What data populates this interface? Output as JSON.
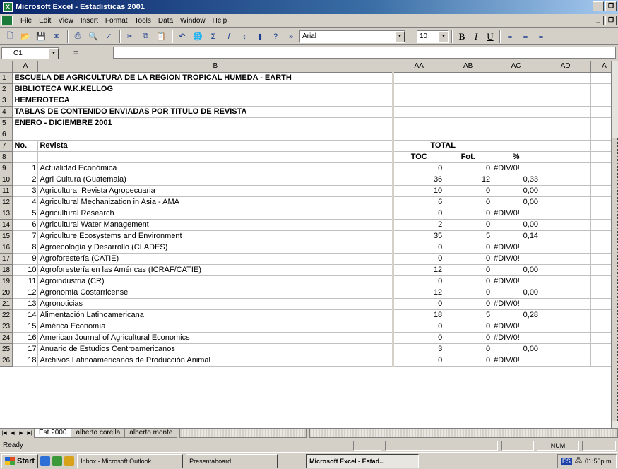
{
  "window": {
    "title": "Microsoft Excel - Estadísticas 2001"
  },
  "menu": [
    "File",
    "Edit",
    "View",
    "Insert",
    "Format",
    "Tools",
    "Data",
    "Window",
    "Help"
  ],
  "toolbar": {
    "font": "Arial",
    "size": "10",
    "bold": "B",
    "italic": "I",
    "underline": "U"
  },
  "formula": {
    "cell": "C1",
    "eq": "="
  },
  "columns": [
    "A",
    "B",
    "AA",
    "AB",
    "AC",
    "AD",
    "A"
  ],
  "header_rows": [
    {
      "n": "1",
      "text": "ESCUELA DE AGRICULTURA DE LA REGION TROPICAL HUMEDA - EARTH"
    },
    {
      "n": "2",
      "text": "BIBLIOTECA W.K.KELLOG"
    },
    {
      "n": "3",
      "text": "HEMEROTECA"
    },
    {
      "n": "4",
      "text": "TABLAS DE CONTENIDO ENVIADAS POR TITULO DE REVISTA"
    },
    {
      "n": "5",
      "text": "ENERO - DICIEMBRE 2001"
    },
    {
      "n": "6",
      "text": ""
    }
  ],
  "labels": {
    "row7_num": "7",
    "no": "No.",
    "revista": "Revista",
    "total": "TOTAL",
    "row8_num": "8",
    "toc": "TOC",
    "fot": "Fot.",
    "pct": "%"
  },
  "rows": [
    {
      "n": "9",
      "no": "1",
      "revista": "Actualidad Económica",
      "toc": "0",
      "fot": "0",
      "pct": "#DIV/0!"
    },
    {
      "n": "10",
      "no": "2",
      "revista": "Agri Cultura (Guatemala)",
      "toc": "36",
      "fot": "12",
      "pct": "0,33"
    },
    {
      "n": "11",
      "no": "3",
      "revista": "Agricultura: Revista Agropecuaria",
      "toc": "10",
      "fot": "0",
      "pct": "0,00"
    },
    {
      "n": "12",
      "no": "4",
      "revista": "Agricultural Mechanization in Asia - AMA",
      "toc": "6",
      "fot": "0",
      "pct": "0,00"
    },
    {
      "n": "13",
      "no": "5",
      "revista": "Agricultural Research",
      "toc": "0",
      "fot": "0",
      "pct": "#DIV/0!"
    },
    {
      "n": "14",
      "no": "6",
      "revista": "Agricultural Water Management",
      "toc": "2",
      "fot": "0",
      "pct": "0,00"
    },
    {
      "n": "15",
      "no": "7",
      "revista": "Agriculture Ecosystems and Environment",
      "toc": "35",
      "fot": "5",
      "pct": "0,14"
    },
    {
      "n": "16",
      "no": "8",
      "revista": "Agroecología y Desarrollo (CLADES)",
      "toc": "0",
      "fot": "0",
      "pct": "#DIV/0!"
    },
    {
      "n": "17",
      "no": "9",
      "revista": "Agroforestería (CATIE)",
      "toc": "0",
      "fot": "0",
      "pct": "#DIV/0!"
    },
    {
      "n": "18",
      "no": "10",
      "revista": "Agroforestería en las Américas (ICRAF/CATIE)",
      "toc": "12",
      "fot": "0",
      "pct": "0,00"
    },
    {
      "n": "19",
      "no": "11",
      "revista": "Agroindustria (CR)",
      "toc": "0",
      "fot": "0",
      "pct": "#DIV/0!"
    },
    {
      "n": "20",
      "no": "12",
      "revista": "Agronomía Costarricense",
      "toc": "12",
      "fot": "0",
      "pct": "0,00"
    },
    {
      "n": "21",
      "no": "13",
      "revista": "Agronoticias",
      "toc": "0",
      "fot": "0",
      "pct": "#DIV/0!"
    },
    {
      "n": "22",
      "no": "14",
      "revista": "Alimentación Latinoamericana",
      "toc": "18",
      "fot": "5",
      "pct": "0,28"
    },
    {
      "n": "23",
      "no": "15",
      "revista": "América Economía",
      "toc": "0",
      "fot": "0",
      "pct": "#DIV/0!"
    },
    {
      "n": "24",
      "no": "16",
      "revista": "American Journal of Agricultural Economics",
      "toc": "0",
      "fot": "0",
      "pct": "#DIV/0!"
    },
    {
      "n": "25",
      "no": "17",
      "revista": "Anuario de Estudios Centroamericanos",
      "toc": "3",
      "fot": "0",
      "pct": "0,00"
    },
    {
      "n": "26",
      "no": "18",
      "revista": "Archivos Latinoamericanos de Producción Animal",
      "toc": "0",
      "fot": "0",
      "pct": "#DIV/0!"
    }
  ],
  "sheet_tabs": [
    "Est.2000",
    "alberto corella",
    "alberto monte"
  ],
  "status": {
    "text": "Ready",
    "num": "NUM"
  },
  "taskbar": {
    "start": "Start",
    "tasks": [
      "Inbox - Microsoft Outlook",
      "Presentaboard",
      "Microsoft Excel - Estad..."
    ],
    "clock": "01:50p.m.",
    "lang": "ES"
  }
}
